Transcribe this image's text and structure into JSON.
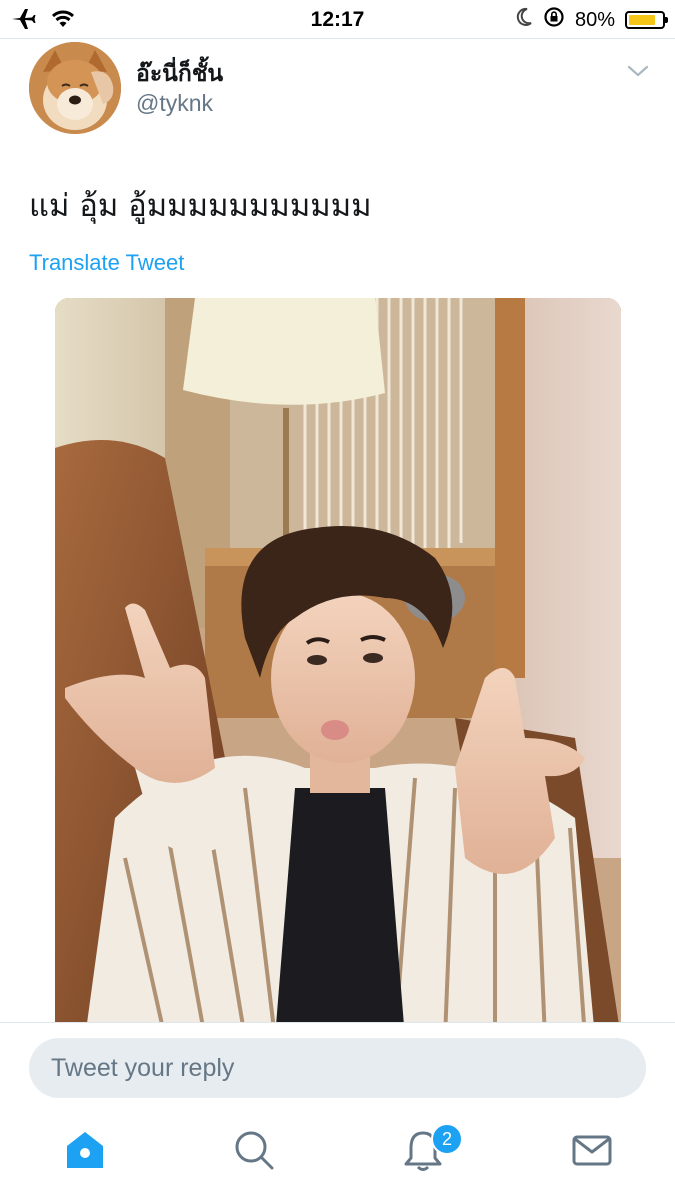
{
  "status_bar": {
    "time": "12:17",
    "battery_percent": "80%",
    "battery_level": 0.8,
    "icons": [
      "airplane-icon",
      "wifi-icon",
      "moon-icon",
      "rotation-lock-icon",
      "battery-icon"
    ]
  },
  "tweet": {
    "display_name": "อ๊ะนี่ก็ชั้น",
    "handle": "@tyknk",
    "text": "แม่ อุ้ม อู้มมมมมมมมมมม",
    "translate_label": "Translate Tweet",
    "avatar_icon": "avatar-image",
    "menu_icon": "chevron-down-icon"
  },
  "reply": {
    "placeholder": "Tweet your reply"
  },
  "tab_bar": {
    "items": [
      {
        "name": "home",
        "icon": "home-icon",
        "active": true
      },
      {
        "name": "search",
        "icon": "search-icon",
        "active": false
      },
      {
        "name": "notifications",
        "icon": "bell-icon",
        "active": false,
        "badge": "2"
      },
      {
        "name": "messages",
        "icon": "envelope-icon",
        "active": false
      }
    ]
  },
  "colors": {
    "accent": "#1da1f2",
    "text": "#14171a",
    "secondary_text": "#657786",
    "input_bg": "#e6ecf0",
    "tab_active": "#1da1f2",
    "tab_inactive": "#657786"
  }
}
